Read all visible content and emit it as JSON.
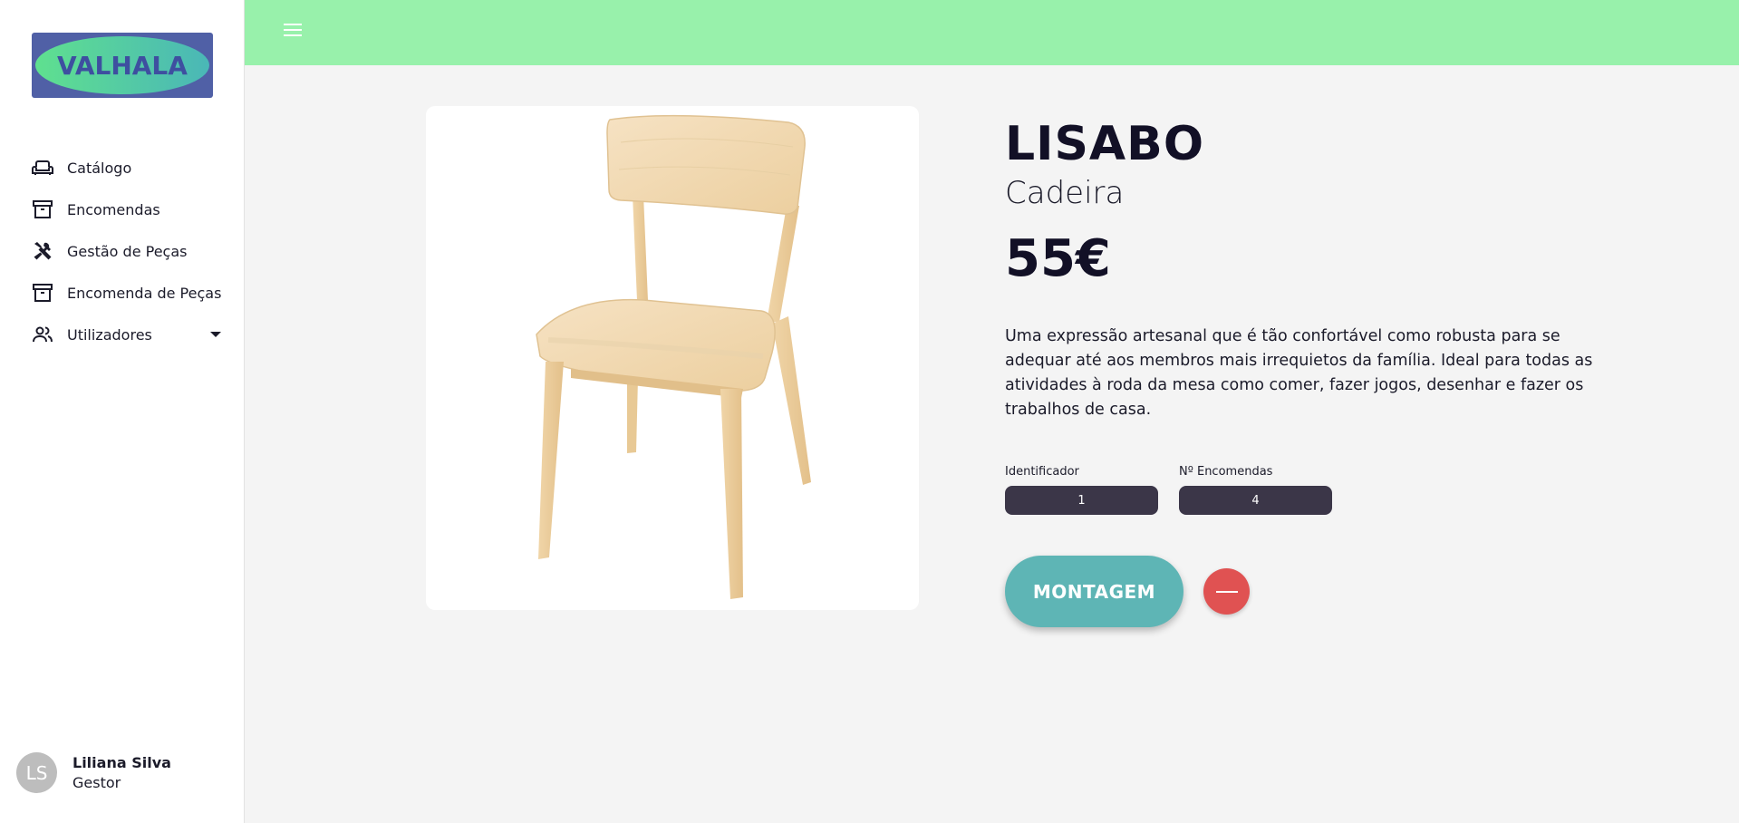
{
  "brand": {
    "logo_text": "VALHALA",
    "logo_bg": "#5060a6"
  },
  "sidebar": {
    "items": [
      {
        "label": "Catálogo",
        "icon": "sofa-icon"
      },
      {
        "label": "Encomendas",
        "icon": "archive-icon"
      },
      {
        "label": "Gestão de Peças",
        "icon": "tools-icon"
      },
      {
        "label": "Encomenda de Peças",
        "icon": "archive-icon"
      },
      {
        "label": "Utilizadores",
        "icon": "users-icon",
        "has_submenu": true
      }
    ]
  },
  "user": {
    "initials": "LS",
    "name": "Liliana Silva",
    "role": "Gestor"
  },
  "topbar": {
    "color": "#98f1ab",
    "menu_icon": "hamburger-icon"
  },
  "product": {
    "name": "LISABO",
    "type": "Cadeira",
    "price": "55€",
    "description": "Uma expressão artesanal que é tão confortável como robusta para se adequar até aos membros mais irrequietos da família. Ideal para todas as atividades à roda da mesa como comer, fazer jogos, desenhar e fazer os trabalhos de casa.",
    "image": "wooden-chair",
    "fields": [
      {
        "label": "Identificador",
        "value": "1"
      },
      {
        "label": "Nº Encomendas",
        "value": "4"
      }
    ],
    "assemble_label": "MONTAGEM",
    "remove_icon": "minus-icon"
  },
  "colors": {
    "accent_button": "#5eb5b5",
    "danger": "#e05252",
    "field_bg": "#3b3648"
  }
}
